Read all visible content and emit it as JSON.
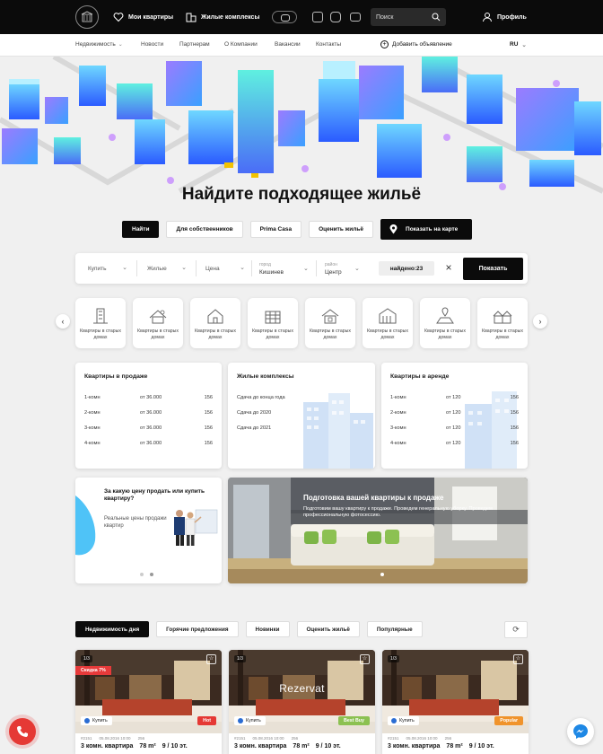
{
  "topbar": {
    "my_apartments": "Мои квартиры",
    "complexes": "Жилые комплексы",
    "search_placeholder": "Поиск",
    "profile": "Профиль"
  },
  "nav": {
    "items": [
      "Недвижимость",
      "Новости",
      "Партнерам",
      "О Компании",
      "Вакансии",
      "Контакты"
    ],
    "add_ad": "Добавить объявление",
    "lang": "RU"
  },
  "hero": {
    "title": "Найдите подходящее жильё"
  },
  "tabs": {
    "find": "Найти",
    "owners": "Для собственников",
    "prima": "Prima Casa",
    "evaluate": "Оценить жильё",
    "map": "Показать на карте"
  },
  "filters": {
    "deal": "Купить",
    "type": "Жилые",
    "price": "Цена",
    "city_label": "город",
    "city": "Кишинев",
    "district_label": "район",
    "district": "Центр",
    "found": "найдено:23",
    "show": "Показать"
  },
  "categories": [
    {
      "label": "Квартиры в старых домах",
      "icon": "building-icon"
    },
    {
      "label": "Квартиры в старых домах",
      "icon": "roof-house-icon"
    },
    {
      "label": "Квартиры в старых домах",
      "icon": "house-icon"
    },
    {
      "label": "Квартиры в старых домах",
      "icon": "apartment-block-icon"
    },
    {
      "label": "Квартиры в старых домах",
      "icon": "cottage-icon"
    },
    {
      "label": "Квартиры в старых домах",
      "icon": "warehouse-icon"
    },
    {
      "label": "Квартиры в старых домах",
      "icon": "land-plot-icon"
    },
    {
      "label": "Квартиры в старых домах",
      "icon": "townhouse-icon"
    }
  ],
  "sale_card": {
    "title": "Квартиры в продаже",
    "rows": [
      {
        "rooms": "1-комн",
        "price": "от 36.000",
        "count": "156"
      },
      {
        "rooms": "2-комн",
        "price": "от 36.000",
        "count": "156"
      },
      {
        "rooms": "3-комн",
        "price": "от 36.000",
        "count": "156"
      },
      {
        "rooms": "4-комн",
        "price": "от 36.000",
        "count": "156"
      }
    ]
  },
  "complex_card": {
    "title": "Жилые комплексы",
    "rows": [
      "Сдача до конца года",
      "Сдача до 2020",
      "Сдача до 2021"
    ]
  },
  "rent_card": {
    "title": "Квартиры в аренде",
    "rows": [
      {
        "rooms": "1-комн",
        "price": "от 120",
        "count": "156"
      },
      {
        "rooms": "2-комн",
        "price": "от 120",
        "count": "156"
      },
      {
        "rooms": "3-комн",
        "price": "от 120",
        "count": "156"
      },
      {
        "rooms": "4-комн",
        "price": "от 120",
        "count": "156"
      }
    ]
  },
  "promo": {
    "question": "За какую цену продать или купить квартиру?",
    "sub": "Реальные цены продажи квартир"
  },
  "banner": {
    "title": "Подготовка вашей квартиры к продаже",
    "sub": "Подготовим вашу квартиру к продаже. Проведем генеральную уборку. Проведем профессиональную фотосессию."
  },
  "bottom_tabs": [
    "Недвижимость дня",
    "Горячие предложения",
    "Новинки",
    "Оценить жильё",
    "Популярные"
  ],
  "listings": [
    {
      "counter": "1/3",
      "sale": "Скидка 7%",
      "buy": "Купить",
      "tag": "Hot",
      "tag_color": "#e53935",
      "id": "#2151",
      "date": "05.08.2016 10:00",
      "views": "256",
      "title": "3 комн. квартира",
      "area": "78 m²",
      "floor": "9 / 10 эт."
    },
    {
      "counter": "1/3",
      "reserved": "Rezervat",
      "buy": "Купить",
      "tag": "Best Buy",
      "tag_color": "#8cc152",
      "id": "#2151",
      "date": "05.08.2016 10:00",
      "views": "256",
      "title": "3 комн. квартира",
      "area": "78 m²",
      "floor": "9 / 10 эт."
    },
    {
      "counter": "1/3",
      "buy": "Купить",
      "tag": "Popular",
      "tag_color": "#f0932b",
      "id": "#2151",
      "date": "05.08.2016 10:00",
      "views": "256",
      "title": "3 комн. квартира",
      "area": "78 m²",
      "floor": "9 / 10 эт."
    }
  ]
}
